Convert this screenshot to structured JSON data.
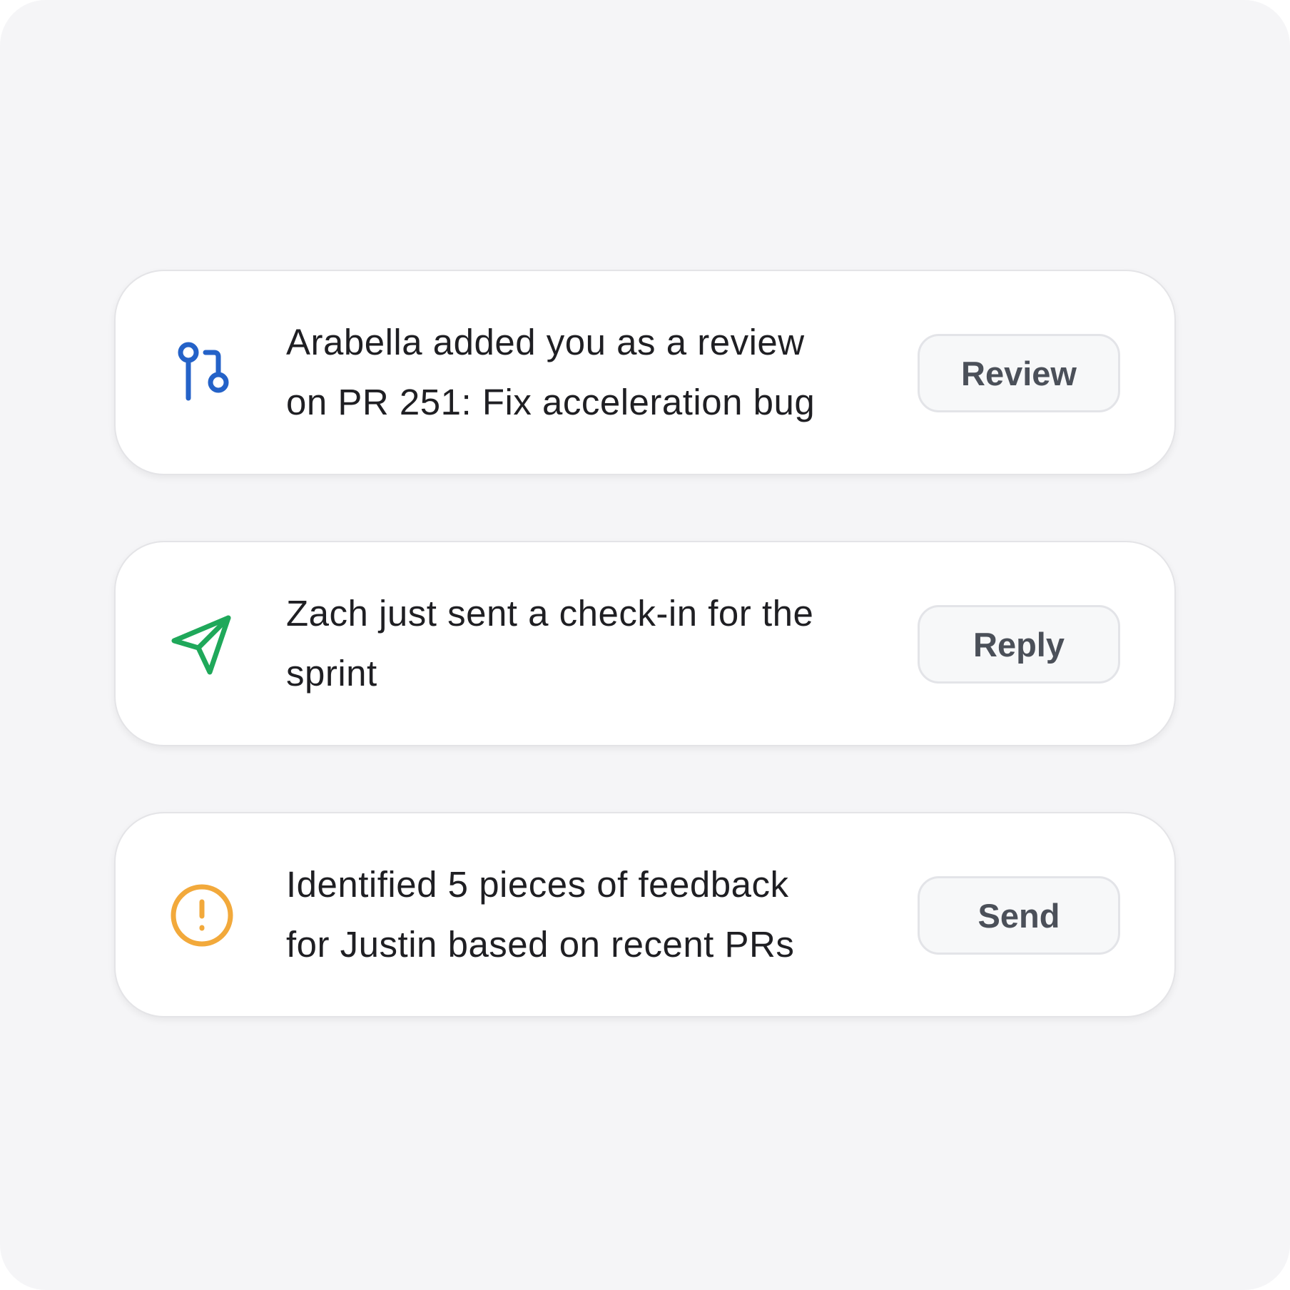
{
  "notifications": [
    {
      "icon": "pull-request-icon",
      "icon_color": "#2462c8",
      "message": "Arabella added you as a review on PR 251: Fix acceleration bug",
      "action_label": "Review"
    },
    {
      "icon": "send-icon",
      "icon_color": "#1fa85a",
      "message": "Zach just sent a check-in for the sprint",
      "action_label": "Reply"
    },
    {
      "icon": "alert-circle-icon",
      "icon_color": "#f2a93b",
      "message": "Identified 5 pieces of feedback for Justin based on recent PRs",
      "action_label": "Send"
    }
  ]
}
